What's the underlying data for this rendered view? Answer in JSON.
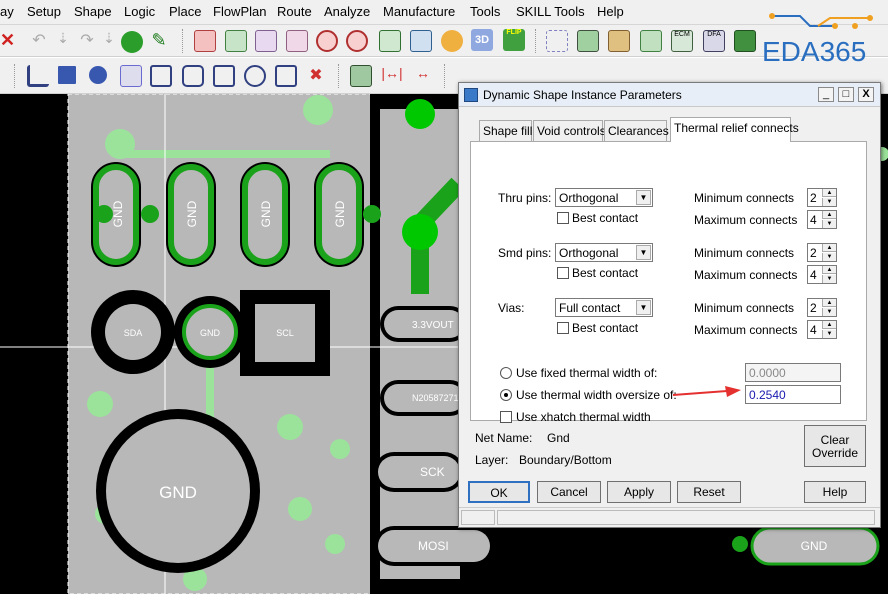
{
  "menu": [
    "ay",
    "Setup",
    "Shape",
    "Logic",
    "Place",
    "FlowPlan",
    "Route",
    "Analyze",
    "Manufacture",
    "Tools",
    "SKILL Tools",
    "Help"
  ],
  "watermark": "EDA365",
  "canvas": {
    "gnd_pads": [
      "GND",
      "GND",
      "GND",
      "GND"
    ],
    "sda_label": "SDA",
    "gnd_small_label": "GND",
    "scl_label": "SCL",
    "gnd_big_label": "GND",
    "right_pads": [
      "3.3VOUT",
      "N20587271",
      "SCK",
      "MOSI"
    ],
    "gnd_right_label": "GND"
  },
  "dialog": {
    "title": "Dynamic Shape Instance Parameters",
    "win_buttons": [
      "_",
      "□",
      "X"
    ],
    "tabs": [
      "Shape fill",
      "Void controls",
      "Clearances",
      "Thermal relief connects"
    ],
    "active_tab": 3,
    "groups": [
      {
        "label": "Thru pins:",
        "mode": "Orthogonal",
        "best_contact": "Best contact",
        "min_label": "Minimum connects",
        "min": "2",
        "max_label": "Maximum connects",
        "max": "4"
      },
      {
        "label": "Smd pins:",
        "mode": "Orthogonal",
        "best_contact": "Best contact",
        "min_label": "Minimum connects",
        "min": "2",
        "max_label": "Maximum connects",
        "max": "4"
      },
      {
        "label": "Vias:",
        "mode": "Full contact",
        "best_contact": "Best contact",
        "min_label": "Minimum connects",
        "min": "2",
        "max_label": "Maximum connects",
        "max": "4"
      }
    ],
    "fixed_width_label": "Use fixed thermal width of:",
    "fixed_width_value": "0.0000",
    "oversize_label": "Use thermal width oversize of:",
    "oversize_value": "0.2540",
    "xhatch_label": "Use xhatch thermal width",
    "net_name_label": "Net Name:",
    "net_name_value": "Gnd",
    "layer_label": "Layer:",
    "layer_value": "Boundary/Bottom",
    "clear_override": "Clear Override",
    "buttons": [
      "OK",
      "Cancel",
      "Apply",
      "Reset",
      "Help"
    ]
  },
  "colors": {
    "copper": "#b8b8b8",
    "thermal": "#1aa31a",
    "via": "#00c800",
    "highlight": "#9be39b",
    "annot": "#e53030"
  }
}
